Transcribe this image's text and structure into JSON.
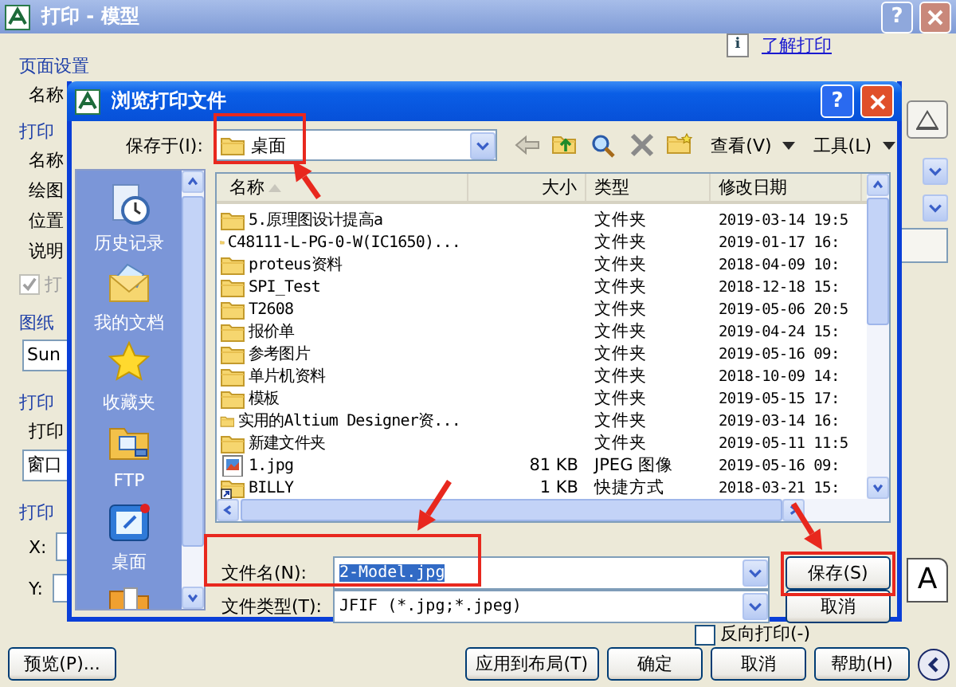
{
  "window": {
    "title": "打印 - 模型",
    "help_glyph": "?",
    "info_glyph": "i",
    "help_link": "了解打印"
  },
  "left_column": [
    {
      "kind": "group",
      "text": "页面设置"
    },
    {
      "kind": "label",
      "text": "名称"
    },
    {
      "kind": "group",
      "text": "打印"
    },
    {
      "kind": "label",
      "text": "名称"
    },
    {
      "kind": "label",
      "text": "绘图"
    },
    {
      "kind": "label",
      "text": "位置"
    },
    {
      "kind": "label",
      "text": "说明"
    },
    {
      "kind": "checkbox",
      "text": "打",
      "checked": true,
      "disabled": true
    },
    {
      "kind": "group",
      "text": "图纸"
    },
    {
      "kind": "field",
      "text": "Sun"
    },
    {
      "kind": "group",
      "text": "打印"
    },
    {
      "kind": "label",
      "text": "打印"
    },
    {
      "kind": "field",
      "text": "窗口"
    },
    {
      "kind": "group",
      "text": "打印"
    },
    {
      "kind": "coord",
      "text": "X:"
    },
    {
      "kind": "coord",
      "text": "Y:"
    }
  ],
  "right_column": {
    "orientation_glyph": "A",
    "reverse_print": {
      "label": "反向打印(-)",
      "checked": false
    }
  },
  "footer": {
    "preview": "预览(P)...",
    "buttons": [
      "应用到布局(T)",
      "确定",
      "取消",
      "帮助(H)"
    ]
  },
  "dialog": {
    "title": "浏览打印文件",
    "help_glyph": "?",
    "save_in": {
      "label": "保存于(I):",
      "value": "桌面"
    },
    "toolbar": {
      "view": "查看(V)",
      "tools": "工具(L)"
    },
    "places": [
      {
        "kind": "history",
        "label": "历史记录"
      },
      {
        "kind": "documents",
        "label": "我的文档"
      },
      {
        "kind": "favorites",
        "label": "收藏夹"
      },
      {
        "kind": "ftp",
        "label": "FTP"
      },
      {
        "kind": "desktop",
        "label": "桌面"
      },
      {
        "kind": "folder"
      }
    ],
    "columns": [
      {
        "label": "名称",
        "sorted": true
      },
      {
        "label": "大小",
        "sorted": false
      },
      {
        "label": "类型",
        "sorted": false
      },
      {
        "label": "修改日期",
        "sorted": false
      }
    ],
    "rows": [
      {
        "kind": "folder",
        "name": "5.原理图设计提高a",
        "size": "",
        "type": "文件夹",
        "date": "2019-03-14 19:5"
      },
      {
        "kind": "folder",
        "name": "C48111-L-PG-0-W(IC1650)...",
        "size": "",
        "type": "文件夹",
        "date": "2019-01-17 16:"
      },
      {
        "kind": "folder",
        "name": "proteus资料",
        "size": "",
        "type": "文件夹",
        "date": "2018-04-09 10:"
      },
      {
        "kind": "folder",
        "name": "SPI_Test",
        "size": "",
        "type": "文件夹",
        "date": "2018-12-18 15:"
      },
      {
        "kind": "folder",
        "name": "T2608",
        "size": "",
        "type": "文件夹",
        "date": "2019-05-06 20:5"
      },
      {
        "kind": "folder",
        "name": "报价单",
        "size": "",
        "type": "文件夹",
        "date": "2019-04-24 15:"
      },
      {
        "kind": "folder",
        "name": "参考图片",
        "size": "",
        "type": "文件夹",
        "date": "2019-05-16 09:"
      },
      {
        "kind": "folder",
        "name": "单片机资料",
        "size": "",
        "type": "文件夹",
        "date": "2018-10-09 14:"
      },
      {
        "kind": "folder",
        "name": "模板",
        "size": "",
        "type": "文件夹",
        "date": "2019-05-15 17:"
      },
      {
        "kind": "folder",
        "name": "实用的Altium Designer资...",
        "size": "",
        "type": "文件夹",
        "date": "2019-03-14 16:"
      },
      {
        "kind": "folder",
        "name": "新建文件夹",
        "size": "",
        "type": "文件夹",
        "date": "2019-05-11 11:5"
      },
      {
        "kind": "image",
        "name": "1.jpg",
        "size": "81 KB",
        "type": "JPEG 图像",
        "date": "2019-05-16 09:"
      },
      {
        "kind": "shortcut",
        "name": "BILLY",
        "size": "1 KB",
        "type": "快捷方式",
        "date": "2018-03-21 15:"
      }
    ],
    "file_name": {
      "label": "文件名(N):",
      "value": "2-Model.jpg",
      "text_selected": true
    },
    "file_type": {
      "label": "文件类型(T):",
      "value": "JFIF (*.jpg;*.jpeg)"
    },
    "save_button": "保存(S)",
    "cancel_button": "取消"
  }
}
